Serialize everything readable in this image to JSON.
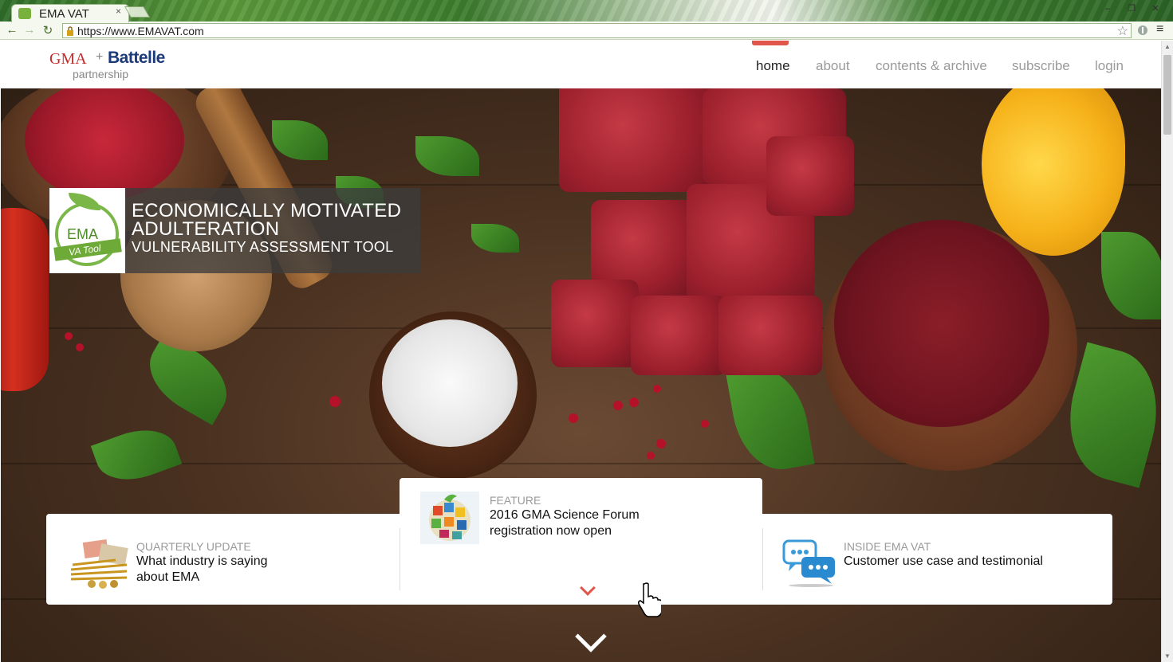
{
  "browser": {
    "tab_title": "EMA VAT",
    "tab_close": "×",
    "url": "https://www.EMAVAT.com",
    "back": "←",
    "forward": "→",
    "reload": "↻",
    "star": "☆",
    "menu": "≡",
    "minimize": "–",
    "restore": "❐",
    "close": "✕"
  },
  "header": {
    "logo": {
      "gma": "GMA",
      "plus": "+",
      "battelle": "Battelle",
      "partnership": "partnership"
    },
    "nav": [
      "home",
      "about",
      "contents & archive",
      "subscribe",
      "login"
    ],
    "active_nav": "home",
    "accent": "#e1564b"
  },
  "hero": {
    "badge_top": "EMA",
    "badge_ribbon": "VA Tool",
    "title_line1": "ECONOMICALLY MOTIVATED",
    "title_line2": "ADULTERATION",
    "title_line3": "VULNERABILITY ASSESSMENT TOOL"
  },
  "cards": [
    {
      "kicker": "QUARTERLY UPDATE",
      "title": "What industry is saying about EMA",
      "thumb": "money-wheat-thumbnail"
    },
    {
      "kicker": "FEATURE",
      "title": "2016 GMA Science Forum registration now open",
      "thumb": "globe-mosaic-thumbnail"
    },
    {
      "kicker": "INSIDE EMA VAT",
      "title": "Customer use case and testimonial",
      "thumb": "chat-bubbles-icon"
    }
  ]
}
